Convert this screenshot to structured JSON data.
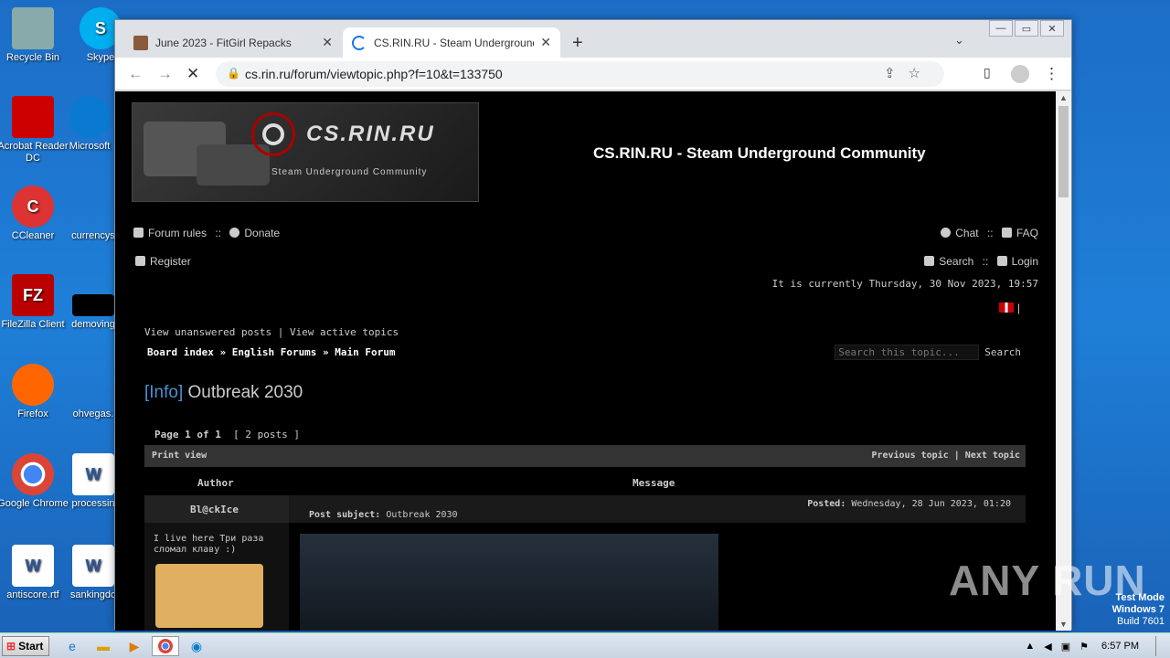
{
  "desktop_icons": [
    {
      "label": "Recycle Bin"
    },
    {
      "label": "Skype"
    },
    {
      "label": "Acrobat Reader DC"
    },
    {
      "label": "Microsoft"
    },
    {
      "label": "CCleaner"
    },
    {
      "label": "currencys"
    },
    {
      "label": "FileZilla Client"
    },
    {
      "label": "demoving"
    },
    {
      "label": "Firefox"
    },
    {
      "label": "ohvegas."
    },
    {
      "label": "Google Chrome"
    },
    {
      "label": "processin"
    },
    {
      "label": "antiscore.rtf"
    },
    {
      "label": "sankingdo"
    }
  ],
  "browser": {
    "tabs": [
      {
        "title": "June 2023 - FitGirl Repacks",
        "active": false
      },
      {
        "title": "CS.RIN.RU - Steam Underground Co",
        "active": true
      }
    ],
    "new_tab": "+",
    "tab_menu": "⌄",
    "window_controls": [
      "—",
      "▭",
      "✕"
    ],
    "url": "cs.rin.ru/forum/viewtopic.php?f=10&t=133750"
  },
  "forum": {
    "logo_name": "CS.RIN.RU",
    "logo_sub": "Steam Underground Community",
    "site_title": "CS.RIN.RU - Steam Underground Community",
    "nav_left": {
      "forum_rules": "Forum rules",
      "sep": "::",
      "donate": "Donate",
      "register": "Register"
    },
    "nav_right": {
      "chat": "Chat",
      "sep": "::",
      "faq": "FAQ",
      "search": "Search",
      "login": "Login"
    },
    "current_time": "It is currently Thursday, 30 Nov 2023, 19:57",
    "lang": "|",
    "view_links": "View unanswered posts | View active topics",
    "breadcrumb": "Board index » English Forums » Main Forum",
    "search_placeholder": "Search this topic...",
    "search_button": "Search",
    "topic_tag": "[Info]",
    "topic_title": "Outbreak 2030",
    "pagination": "Page 1 of 1",
    "posts_count": "[ 2 posts ]",
    "print_view": "Print view",
    "prev_next": "Previous topic | Next topic",
    "col_author": "Author",
    "col_message": "Message",
    "author": "Bl@ckIce",
    "posted_label": "Posted:",
    "posted_date": "Wednesday, 28 Jun 2023, 01:20",
    "subject_label": "Post subject:",
    "subject": "Outbreak 2030",
    "signature": "I live here Три раза сломал клаву :)"
  },
  "taskbar": {
    "start": "Start",
    "time": "6:57 PM"
  },
  "watermark": "ANY RUN",
  "test_mode": {
    "line1": "Test Mode",
    "line2": "Windows 7",
    "line3": "Build 7601"
  }
}
